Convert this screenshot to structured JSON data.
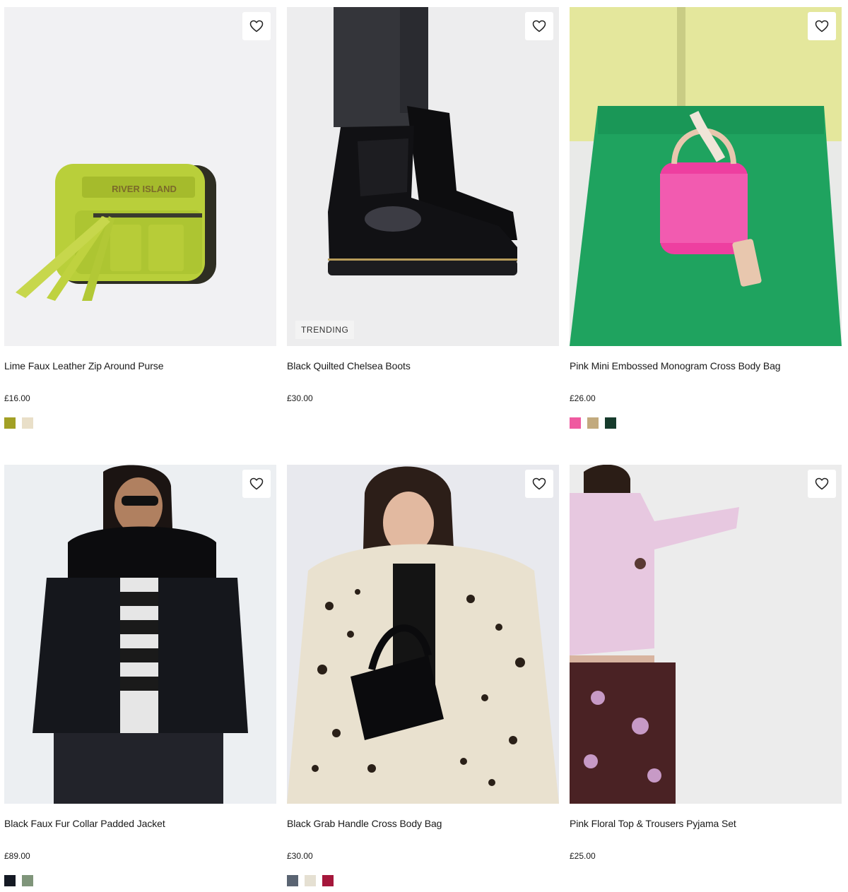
{
  "products": [
    {
      "name": "Lime Faux Leather Zip Around Purse",
      "price": "£16.00",
      "image": "lime-purse-photo",
      "swatches": [
        "#a2a025",
        "#e9dfc8"
      ]
    },
    {
      "name": "Black Quilted Chelsea Boots",
      "price": "£30.00",
      "image": "black-chelsea-boots-photo",
      "badge": "TRENDING",
      "swatches": []
    },
    {
      "name": "Pink Mini Embossed Monogram Cross Body Bag",
      "price": "£26.00",
      "image": "pink-cross-body-bag-photo",
      "swatches": [
        "#ef5aa0",
        "#c2aa7e",
        "#163b2c"
      ]
    },
    {
      "name": "Black Faux Fur Collar Padded Jacket",
      "price": "£89.00",
      "image": "black-padded-jacket-photo",
      "swatches": [
        "#151a24",
        "#7f957a"
      ]
    },
    {
      "name": "Black Grab Handle Cross Body Bag",
      "price": "£30.00",
      "image": "grab-handle-bag-photo",
      "swatches": [
        "#5a6472",
        "#e5e0d2",
        "#a5173b"
      ]
    },
    {
      "name": "Pink Floral Top & Trousers Pyjama Set",
      "price": "£25.00",
      "image": "pink-floral-pyjama-photo",
      "swatches": []
    }
  ],
  "icons": {
    "wishlist": "heart-icon"
  }
}
